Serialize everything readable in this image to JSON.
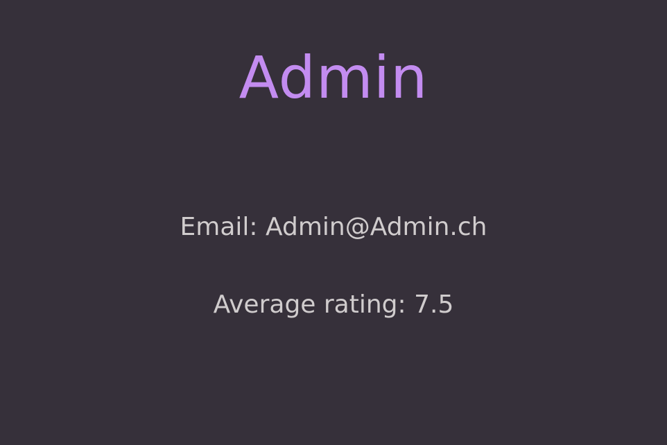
{
  "profile": {
    "username": "Admin",
    "email_label": "Email:",
    "email": "Admin@Admin.ch",
    "rating_label": "Average rating:",
    "rating": "7.5"
  },
  "colors": {
    "background": "#36303a",
    "username": "#c38cf0",
    "text": "#d0cccd"
  }
}
